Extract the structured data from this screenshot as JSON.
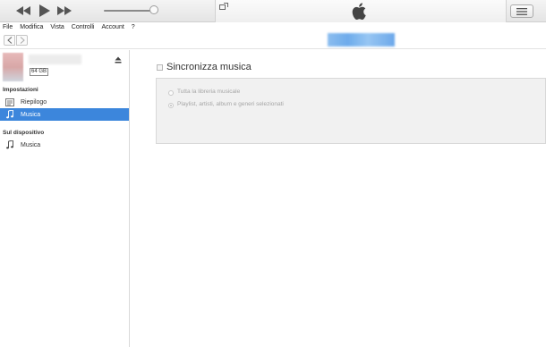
{
  "toolbar": {
    "icons": [
      "rewind-icon",
      "play-icon",
      "fast-forward-icon",
      "miniplayer-icon",
      "apple-logo",
      "list-view-icon"
    ]
  },
  "menu": {
    "items": [
      "File",
      "Modifica",
      "Vista",
      "Controlli",
      "Account",
      "?"
    ]
  },
  "sidebar": {
    "device": {
      "capacity": "64 GB"
    },
    "settings_label": "Impostazioni",
    "settings_items": [
      {
        "label": "Riepilogo",
        "icon": "summary-icon",
        "selected": false
      },
      {
        "label": "Musica",
        "icon": "music-note-icon",
        "selected": true
      }
    ],
    "on_device_label": "Sul dispositivo",
    "device_items": [
      {
        "label": "Musica",
        "icon": "music-note-icon"
      }
    ]
  },
  "main": {
    "sync_title": "Sincronizza musica",
    "sync_checked": false,
    "options": [
      {
        "label": "Tutta la libreria musicale",
        "selected": false
      },
      {
        "label": "Playlist, artisti, album e generi selezionati",
        "selected": true
      }
    ]
  },
  "colors": {
    "selection": "#3c86dc",
    "device_tag": "#5fa3ea"
  }
}
